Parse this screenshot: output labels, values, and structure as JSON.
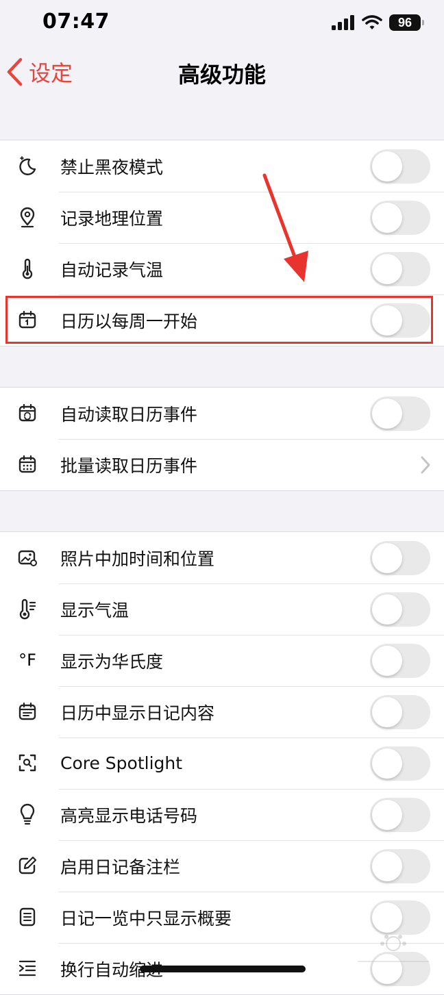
{
  "status_bar": {
    "time": "07:47",
    "battery": "96"
  },
  "nav": {
    "back_label": "设定",
    "title": "高级功能"
  },
  "accent_color": "#e8453c",
  "groups": [
    {
      "rows": [
        {
          "icon": "moon-icon",
          "label": "禁止黑夜模式",
          "control": "toggle",
          "on": false
        },
        {
          "icon": "location-pin-icon",
          "label": "记录地理位置",
          "control": "toggle",
          "on": false
        },
        {
          "icon": "thermometer-icon",
          "label": "自动记录气温",
          "control": "toggle",
          "on": false
        },
        {
          "icon": "calendar-one-icon",
          "label": "日历以每周一开始",
          "control": "toggle",
          "on": false
        }
      ]
    },
    {
      "rows": [
        {
          "icon": "calendar-sync-icon",
          "label": "自动读取日历事件",
          "control": "toggle",
          "on": false
        },
        {
          "icon": "calendar-grid-icon",
          "label": "批量读取日历事件",
          "control": "chevron"
        }
      ]
    },
    {
      "rows": [
        {
          "icon": "photo-icon",
          "label": "照片中加时间和位置",
          "control": "toggle",
          "on": false
        },
        {
          "icon": "thermometer-lines-icon",
          "label": "显示气温",
          "control": "toggle",
          "on": false
        },
        {
          "icon": "fahrenheit-icon",
          "label": "显示为华氏度",
          "control": "toggle",
          "on": false
        },
        {
          "icon": "calendar-list-icon",
          "label": "日历中显示日记内容",
          "control": "toggle",
          "on": false
        },
        {
          "icon": "spotlight-icon",
          "label": "Core Spotlight",
          "control": "toggle",
          "on": false
        },
        {
          "icon": "lightbulb-icon",
          "label": "高亮显示电话号码",
          "control": "toggle",
          "on": false
        },
        {
          "icon": "edit-icon",
          "label": "启用日记备注栏",
          "control": "toggle",
          "on": false
        },
        {
          "icon": "document-icon",
          "label": "日记一览中只显示概要",
          "control": "toggle",
          "on": false
        },
        {
          "icon": "indent-icon",
          "label": "换行自动缩进",
          "control": "toggle",
          "on": false
        }
      ]
    }
  ],
  "fahrenheit_symbol": "°F"
}
